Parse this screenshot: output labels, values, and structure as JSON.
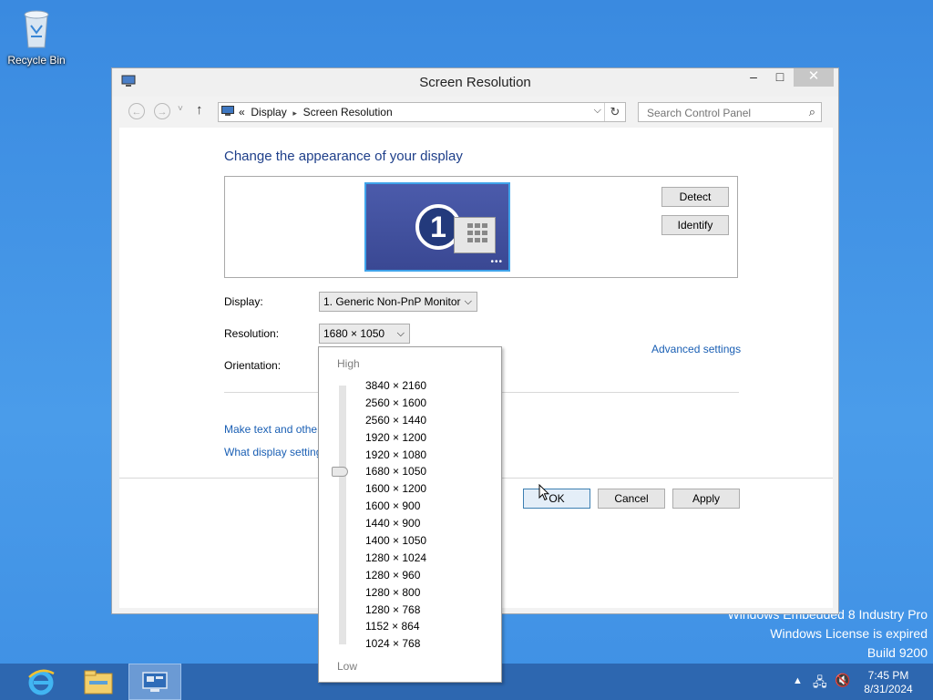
{
  "desktop": {
    "recycle_bin_label": "Recycle Bin",
    "watermark": [
      "Windows Embedded 8 Industry Pro",
      "Windows License is expired",
      "Build 9200"
    ]
  },
  "window": {
    "title": "Screen Resolution",
    "min_glyph": "–",
    "max_glyph": "□",
    "close_glyph": "✕"
  },
  "navbar": {
    "back_glyph": "←",
    "forward_glyph": "→",
    "recent_glyph": "˅",
    "up_glyph": "↑",
    "breadcrumb_prefix": "«",
    "breadcrumb": [
      "Display",
      "Screen Resolution"
    ],
    "breadcrumb_separator": "▸",
    "search_placeholder": "Search Control Panel"
  },
  "main": {
    "heading": "Change the appearance of your display",
    "monitor_number": "1",
    "detect_label": "Detect",
    "identify_label": "Identify",
    "display_label": "Display:",
    "display_value": "1. Generic Non-PnP Monitor",
    "resolution_label": "Resolution:",
    "resolution_value": "1680 × 1050",
    "orientation_label": "Orientation:",
    "advanced_link": "Advanced settings",
    "link_text_size": "Make text and other",
    "link_display_settings": "What display setting",
    "ok_label": "OK",
    "cancel_label": "Cancel",
    "apply_label": "Apply"
  },
  "resolution_popup": {
    "high_label": "High",
    "low_label": "Low",
    "options": [
      "3840 × 2160",
      "2560 × 1600",
      "2560 × 1440",
      "1920 × 1200",
      "1920 × 1080",
      "1680 × 1050",
      "1600 × 1200",
      "1600 × 900",
      "1440 × 900",
      "1400 × 1050",
      "1280 × 1024",
      "1280 × 960",
      "1280 × 800",
      "1280 × 768",
      "1152 × 864",
      "1024 × 768"
    ],
    "selected": "1680 × 1050"
  },
  "taskbar": {
    "time": "7:45 PM",
    "date": "8/31/2024"
  },
  "colors": {
    "accent_link": "#1a5fb4",
    "heading": "#1e3f8a",
    "desktop": "#3c8fe3",
    "taskbar": "#2d67b0"
  }
}
